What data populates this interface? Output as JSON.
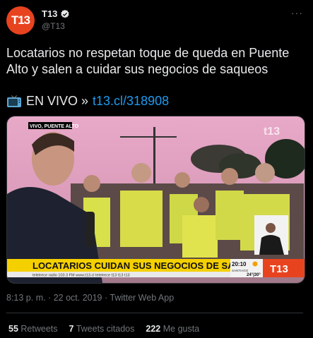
{
  "tweet": {
    "avatar_text": "T13",
    "display_name": "T13",
    "handle": "@T13",
    "more": "···",
    "text": "Locatarios no respetan toque de queda en Puente Alto y salen a cuidar sus negocios de saqueos",
    "live_prefix": "EN VIVO »",
    "link": "t13.cl/318908",
    "timestamp": "8:13 p. m. · 22 oct. 2019 · Twitter Web App"
  },
  "media": {
    "vivo_label": "VIVO, PUENTE ALTO",
    "watermark": "t13",
    "headline": "LOCATARIOS CUIDAN SUS NEGOCIOS DE SAQUEOS",
    "ticker": "teletrece radio 103.3 FM   www.t13.cl   teletrece   t13   t13   t13",
    "clock": "20:10",
    "city": "SANTIAGO",
    "temp": "24°|30°",
    "logo": "T13"
  },
  "stats": {
    "retweets_count": "55",
    "retweets_label": "Retweets",
    "quotes_count": "7",
    "quotes_label": "Tweets citados",
    "likes_count": "222",
    "likes_label": "Me gusta"
  },
  "colors": {
    "brand": "#e8431f",
    "link": "#1d9bf0",
    "muted": "#71767b",
    "headline_bar": "#f5d000"
  },
  "icons": [
    "verified-icon",
    "more-icon",
    "tv-icon",
    "sun-icon"
  ]
}
